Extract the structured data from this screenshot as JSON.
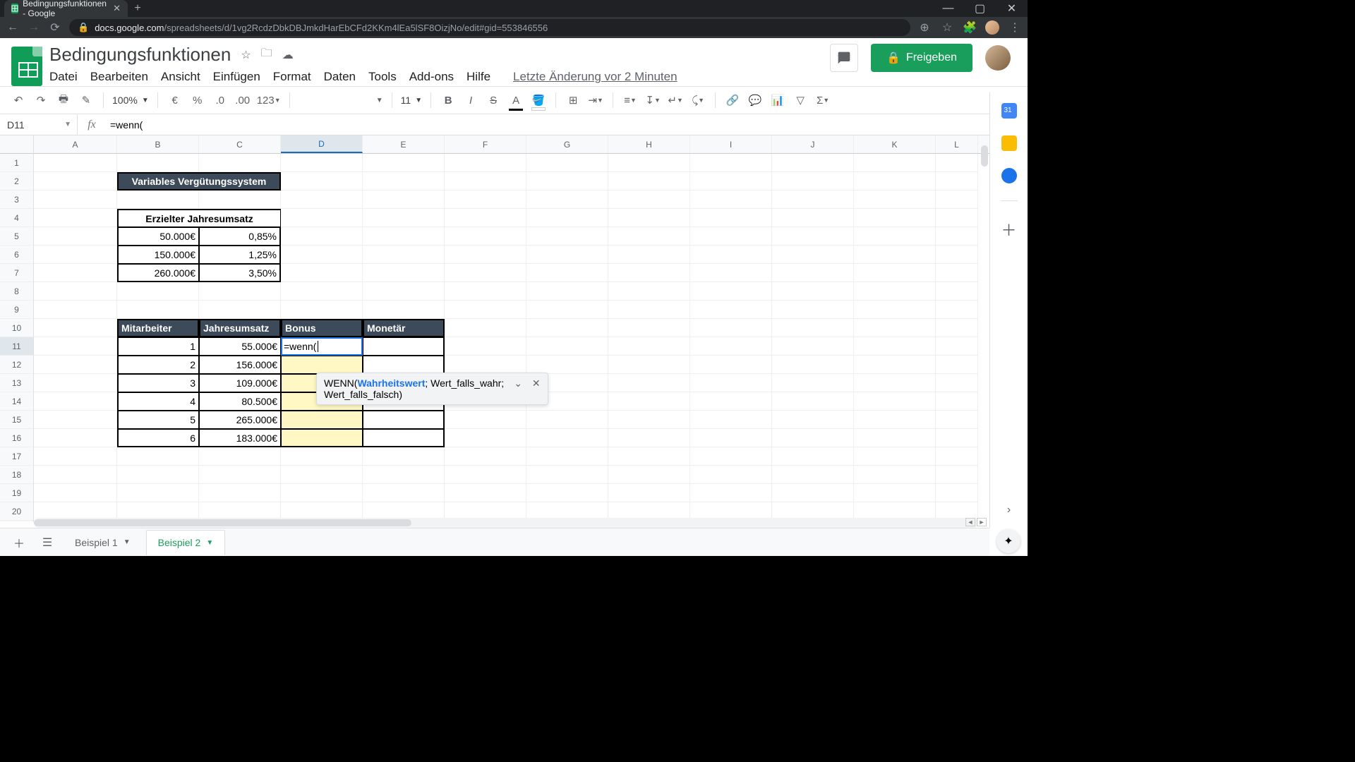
{
  "browser": {
    "tab_title": "Bedingungsfunktionen - Google",
    "url_host": "docs.google.com",
    "url_path": "/spreadsheets/d/1vg2RcdzDbkDBJmkdHarEbCFd2KKm4lEa5lSF8OizjNo/edit#gid=553846556"
  },
  "doc": {
    "title": "Bedingungsfunktionen",
    "last_edit": "Letzte Änderung vor 2 Minuten",
    "share": "Freigeben"
  },
  "menu": {
    "file": "Datei",
    "edit": "Bearbeiten",
    "view": "Ansicht",
    "insert": "Einfügen",
    "format": "Format",
    "data": "Daten",
    "tools": "Tools",
    "addons": "Add-ons",
    "help": "Hilfe"
  },
  "toolbar": {
    "zoom": "100%",
    "font_size": "11",
    "num_format": "123"
  },
  "fx": {
    "cell_ref": "D11",
    "formula": "=wenn("
  },
  "columns": [
    "A",
    "B",
    "C",
    "D",
    "E",
    "F",
    "G",
    "H",
    "I",
    "J",
    "K",
    "L"
  ],
  "rows": [
    1,
    2,
    3,
    4,
    5,
    6,
    7,
    8,
    9,
    10,
    11,
    12,
    13,
    14,
    15,
    16,
    17,
    18,
    19,
    20
  ],
  "table1": {
    "title": "Variables Vergütungssystem",
    "subtitle": "Erzielter Jahresumsatz",
    "rows": [
      {
        "amt": "50.000€",
        "pct": "0,85%"
      },
      {
        "amt": "150.000€",
        "pct": "1,25%"
      },
      {
        "amt": "260.000€",
        "pct": "3,50%"
      }
    ]
  },
  "table2": {
    "headers": {
      "a": "Mitarbeiter",
      "b": "Jahresumsatz",
      "c": "Bonus",
      "d": "Monetär"
    },
    "rows": [
      {
        "id": "1",
        "rev": "55.000€"
      },
      {
        "id": "2",
        "rev": "156.000€"
      },
      {
        "id": "3",
        "rev": "109.000€"
      },
      {
        "id": "4",
        "rev": "80.500€"
      },
      {
        "id": "5",
        "rev": "265.000€"
      },
      {
        "id": "6",
        "rev": "183.000€"
      }
    ]
  },
  "edit": {
    "content": "=wenn("
  },
  "tooltip": {
    "fn": "WENN(",
    "arg1": "Wahrheitswert",
    "sep1": "; ",
    "arg2": "Wert_falls_wahr",
    "sep2": ";",
    "arg3": "Wert_falls_falsch",
    "end": ")"
  },
  "sheets": {
    "tab1": "Beispiel 1",
    "tab2": "Beispiel 2"
  }
}
